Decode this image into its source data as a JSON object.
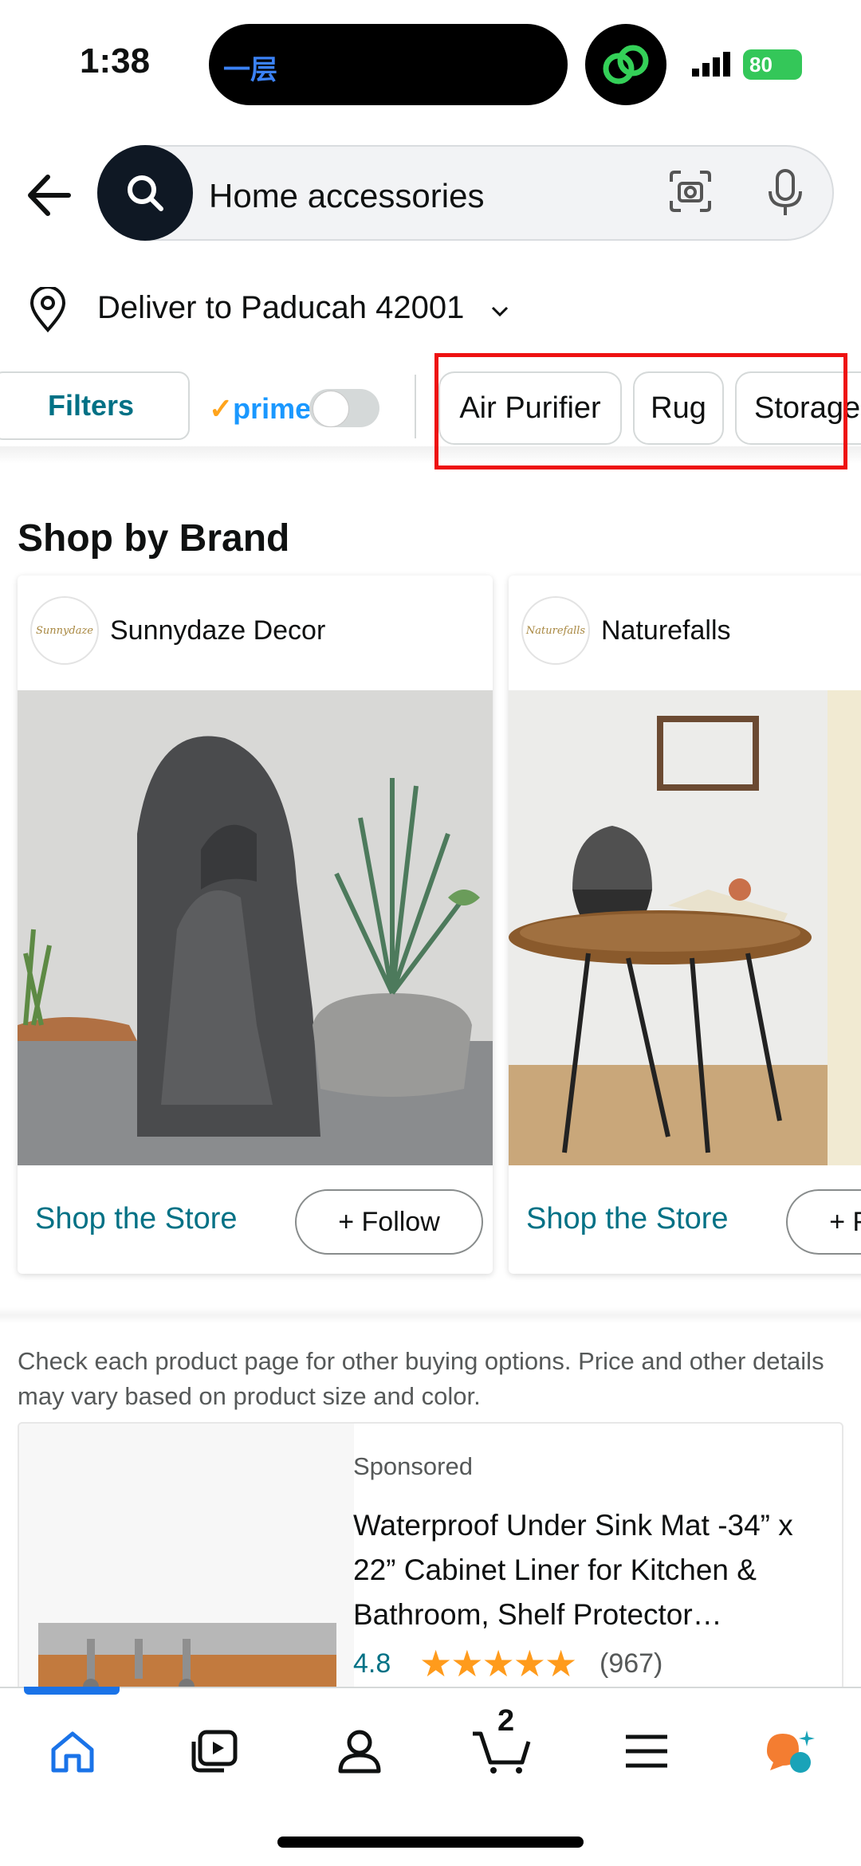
{
  "status_bar": {
    "time": "1:38",
    "island_label": "一层",
    "battery": "80"
  },
  "search": {
    "query": "Home accessories"
  },
  "delivery": {
    "label": "Deliver to Paducah 42001"
  },
  "filters": {
    "filters_label": "Filters",
    "prime_label": "prime",
    "prime_toggle_on": false,
    "chips": [
      "Air Purifier",
      "Rug",
      "Storage"
    ]
  },
  "shop_by_brand": {
    "heading": "Shop by Brand",
    "brands": [
      {
        "name": "Sunnydaze Decor",
        "logo_text": "Sunnydaze",
        "shop_label": "Shop the Store",
        "follow_label": "+ Follow"
      },
      {
        "name": "Naturefalls",
        "logo_text": "Naturefalls",
        "shop_label": "Shop the Store",
        "follow_label": "+ Follow"
      }
    ]
  },
  "disclaimer": "Check each product page for other buying options. Price and other details may vary based on product size and color.",
  "product": {
    "sponsored_label": "Sponsored",
    "title": "Waterproof Under Sink Mat -34” x 22” Cabinet Liner for Kitchen & Bathroom, Shelf Protector…",
    "rating": "4.8",
    "stars": "★★★★★",
    "review_count": "(967)"
  },
  "bottom_nav": {
    "items": [
      "home-icon",
      "video-icon",
      "account-icon",
      "cart-icon",
      "menu-icon",
      "rufus-icon"
    ],
    "cart_count": "2"
  },
  "colors": {
    "link": "#007185",
    "star": "#ff9b1c",
    "active_nav": "#1a73e8",
    "highlight": "#ee1111"
  }
}
